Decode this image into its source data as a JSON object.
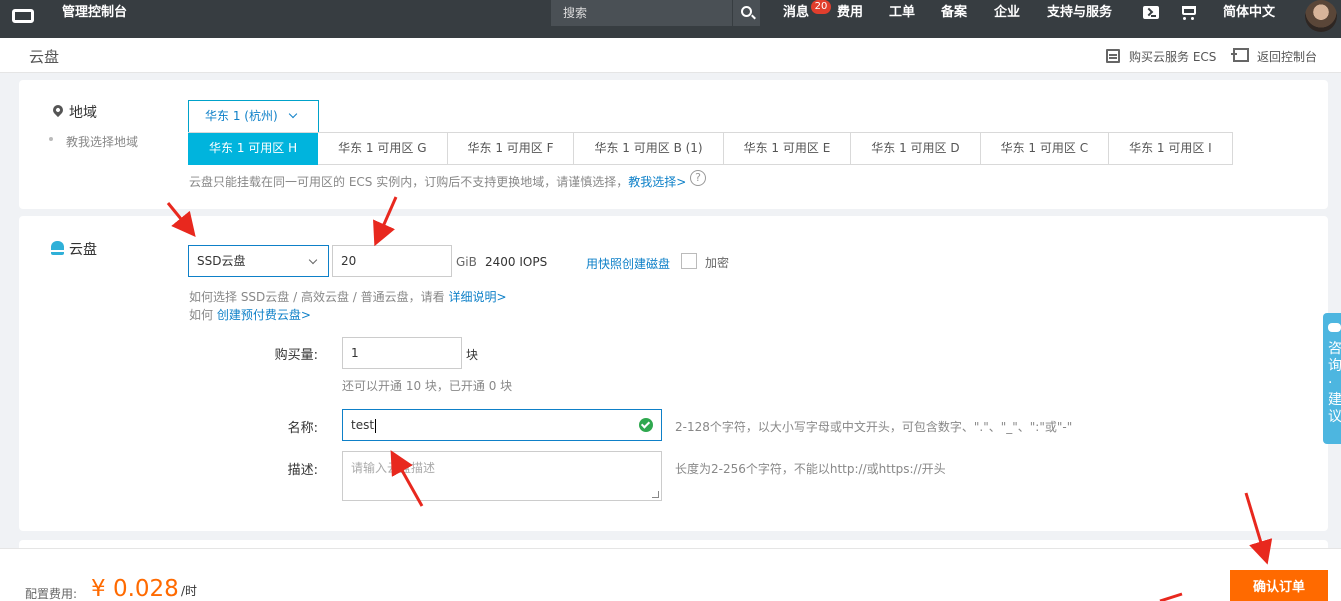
{
  "topbar": {
    "logo_icon": "aliyun-logo-icon",
    "console_title": "管理控制台",
    "search_placeholder": "搜索",
    "nav": {
      "messages": "消息",
      "messages_badge": "20",
      "billing": "费用",
      "tickets": "工单",
      "icp": "备案",
      "enterprise": "企业",
      "support": "支持与服务",
      "language": "简体中文"
    }
  },
  "subheader": {
    "title": "云盘",
    "buy_ecs": "购买云服务 ECS",
    "back_console": "返回控制台"
  },
  "region": {
    "section_title": "地域",
    "help_link": "教我选择地域",
    "selected_region": "华东 1 (杭州)",
    "zones": [
      "华东 1 可用区 H",
      "华东 1 可用区 G",
      "华东 1 可用区 F",
      "华东 1 可用区 B (1)",
      "华东 1 可用区 E",
      "华东 1 可用区 D",
      "华东 1 可用区 C",
      "华东 1 可用区 I"
    ],
    "active_zone": "华东 1 可用区 H",
    "note": "云盘只能挂载在同一可用区的 ECS 实例内，订购后不支持更换地域，请谨慎选择，",
    "note_link": "教我选择>",
    "help_icon": "?"
  },
  "disk": {
    "section_title": "云盘",
    "type_value": "SSD云盘",
    "size_value": "20",
    "size_unit": "GiB",
    "iops": "2400 IOPS",
    "snapshot_link": "用快照创建磁盘",
    "encrypt_label": "加密",
    "encrypt_checked": false,
    "type_help_prefix": "如何选择 SSD云盘 / 高效云盘 / 普通云盘，请看",
    "type_help_link": "详细说明>",
    "prepaid_prefix": "如何",
    "prepaid_link": "创建预付费云盘>",
    "quantity_label": "购买量:",
    "quantity_value": "1",
    "quantity_unit": "块",
    "quantity_note": "还可以开通 10 块，已开通 0 块",
    "name_label": "名称:",
    "name_value": "test",
    "name_hint": "2-128个字符，以大小写字母或中文开头，可包含数字、\".\"、\"_\"、\":\"或\"-\"",
    "desc_label": "描述:",
    "desc_placeholder": "请输入云盘描述",
    "desc_hint": "长度为2-256个字符，不能以http://或https://开头"
  },
  "footer": {
    "fee_label": "配置费用:",
    "fee_value": "¥ 0.028",
    "fee_unit": "/时",
    "confirm_button": "确认订单"
  },
  "side_tab": {
    "text": "咨询·建议"
  },
  "colors": {
    "topbar_bg": "#373d41",
    "accent_blue": "#00b4dd",
    "link_blue": "#0e80c8",
    "price_orange": "#ff6a00",
    "annotation_red": "#e8281e"
  }
}
